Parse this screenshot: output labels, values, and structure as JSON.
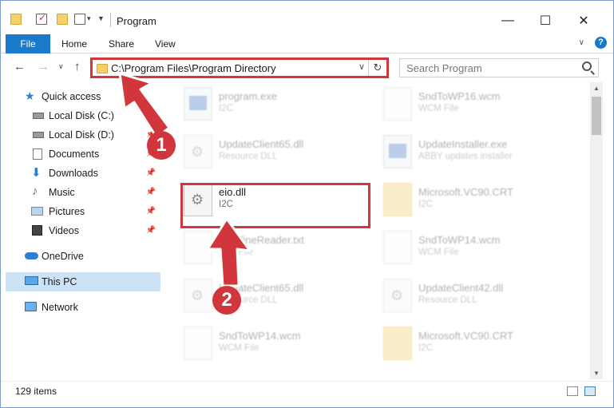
{
  "window": {
    "title": "Program",
    "controls": {
      "minimize": "—",
      "maximize": "☐",
      "close": "✕"
    }
  },
  "ribbon": {
    "tabs": [
      "File",
      "Home",
      "Share",
      "View"
    ],
    "help": "?"
  },
  "nav": {
    "address": "C:\\Program Files\\Program Directory",
    "search_placeholder": "Search Program"
  },
  "sidebar": {
    "items": [
      {
        "label": "Quick access",
        "icon": "star-icon"
      },
      {
        "label": "Local Disk (C:)",
        "icon": "drive-icon"
      },
      {
        "label": "Local Disk (D:)",
        "icon": "drive-icon"
      },
      {
        "label": "Documents",
        "icon": "documents-icon"
      },
      {
        "label": "Downloads",
        "icon": "download-icon"
      },
      {
        "label": "Music",
        "icon": "music-icon"
      },
      {
        "label": "Pictures",
        "icon": "pictures-icon"
      },
      {
        "label": "Videos",
        "icon": "videos-icon"
      },
      {
        "label": "OneDrive",
        "icon": "cloud-icon"
      },
      {
        "label": "This PC",
        "icon": "computer-icon"
      },
      {
        "label": "Network",
        "icon": "network-icon"
      }
    ]
  },
  "files": [
    {
      "name": "program.exe",
      "type": "I2C",
      "icon": "exe-icon"
    },
    {
      "name": "SndToWP16.wcm",
      "type": "WCM File",
      "icon": "document-icon"
    },
    {
      "name": "UpdateClient65.dll",
      "type": "Resource DLL",
      "icon": "dll-icon"
    },
    {
      "name": "UpdateInstaller.exe",
      "type": "ABBY updates installer",
      "icon": "exe-icon"
    },
    {
      "name": "eio.dll",
      "type": "I2C",
      "icon": "dll-icon"
    },
    {
      "name": "Microsoft.VC90.CRT",
      "type": "I2C",
      "icon": "folder-icon"
    },
    {
      "name": "App.fineReader.txt",
      "type": "Text File",
      "icon": "document-icon"
    },
    {
      "name": "SndToWP14.wcm",
      "type": "WCM File",
      "icon": "document-icon"
    },
    {
      "name": "UpdateClient65.dll",
      "type": "Resource DLL",
      "icon": "dll-icon"
    },
    {
      "name": "UpdateClient42.dll",
      "type": "Resource DLL",
      "icon": "dll-icon"
    },
    {
      "name": "SndToWP14.wcm",
      "type": "WCM File",
      "icon": "document-icon"
    },
    {
      "name": "Microsoft.VC90.CRT",
      "type": "I2C",
      "icon": "folder-icon"
    }
  ],
  "status": {
    "item_count": "129 items"
  },
  "callouts": {
    "one": "1",
    "two": "2"
  },
  "colors": {
    "accent": "#1979ca",
    "annotation": "#d0363b",
    "selection": "#cce3f7"
  }
}
